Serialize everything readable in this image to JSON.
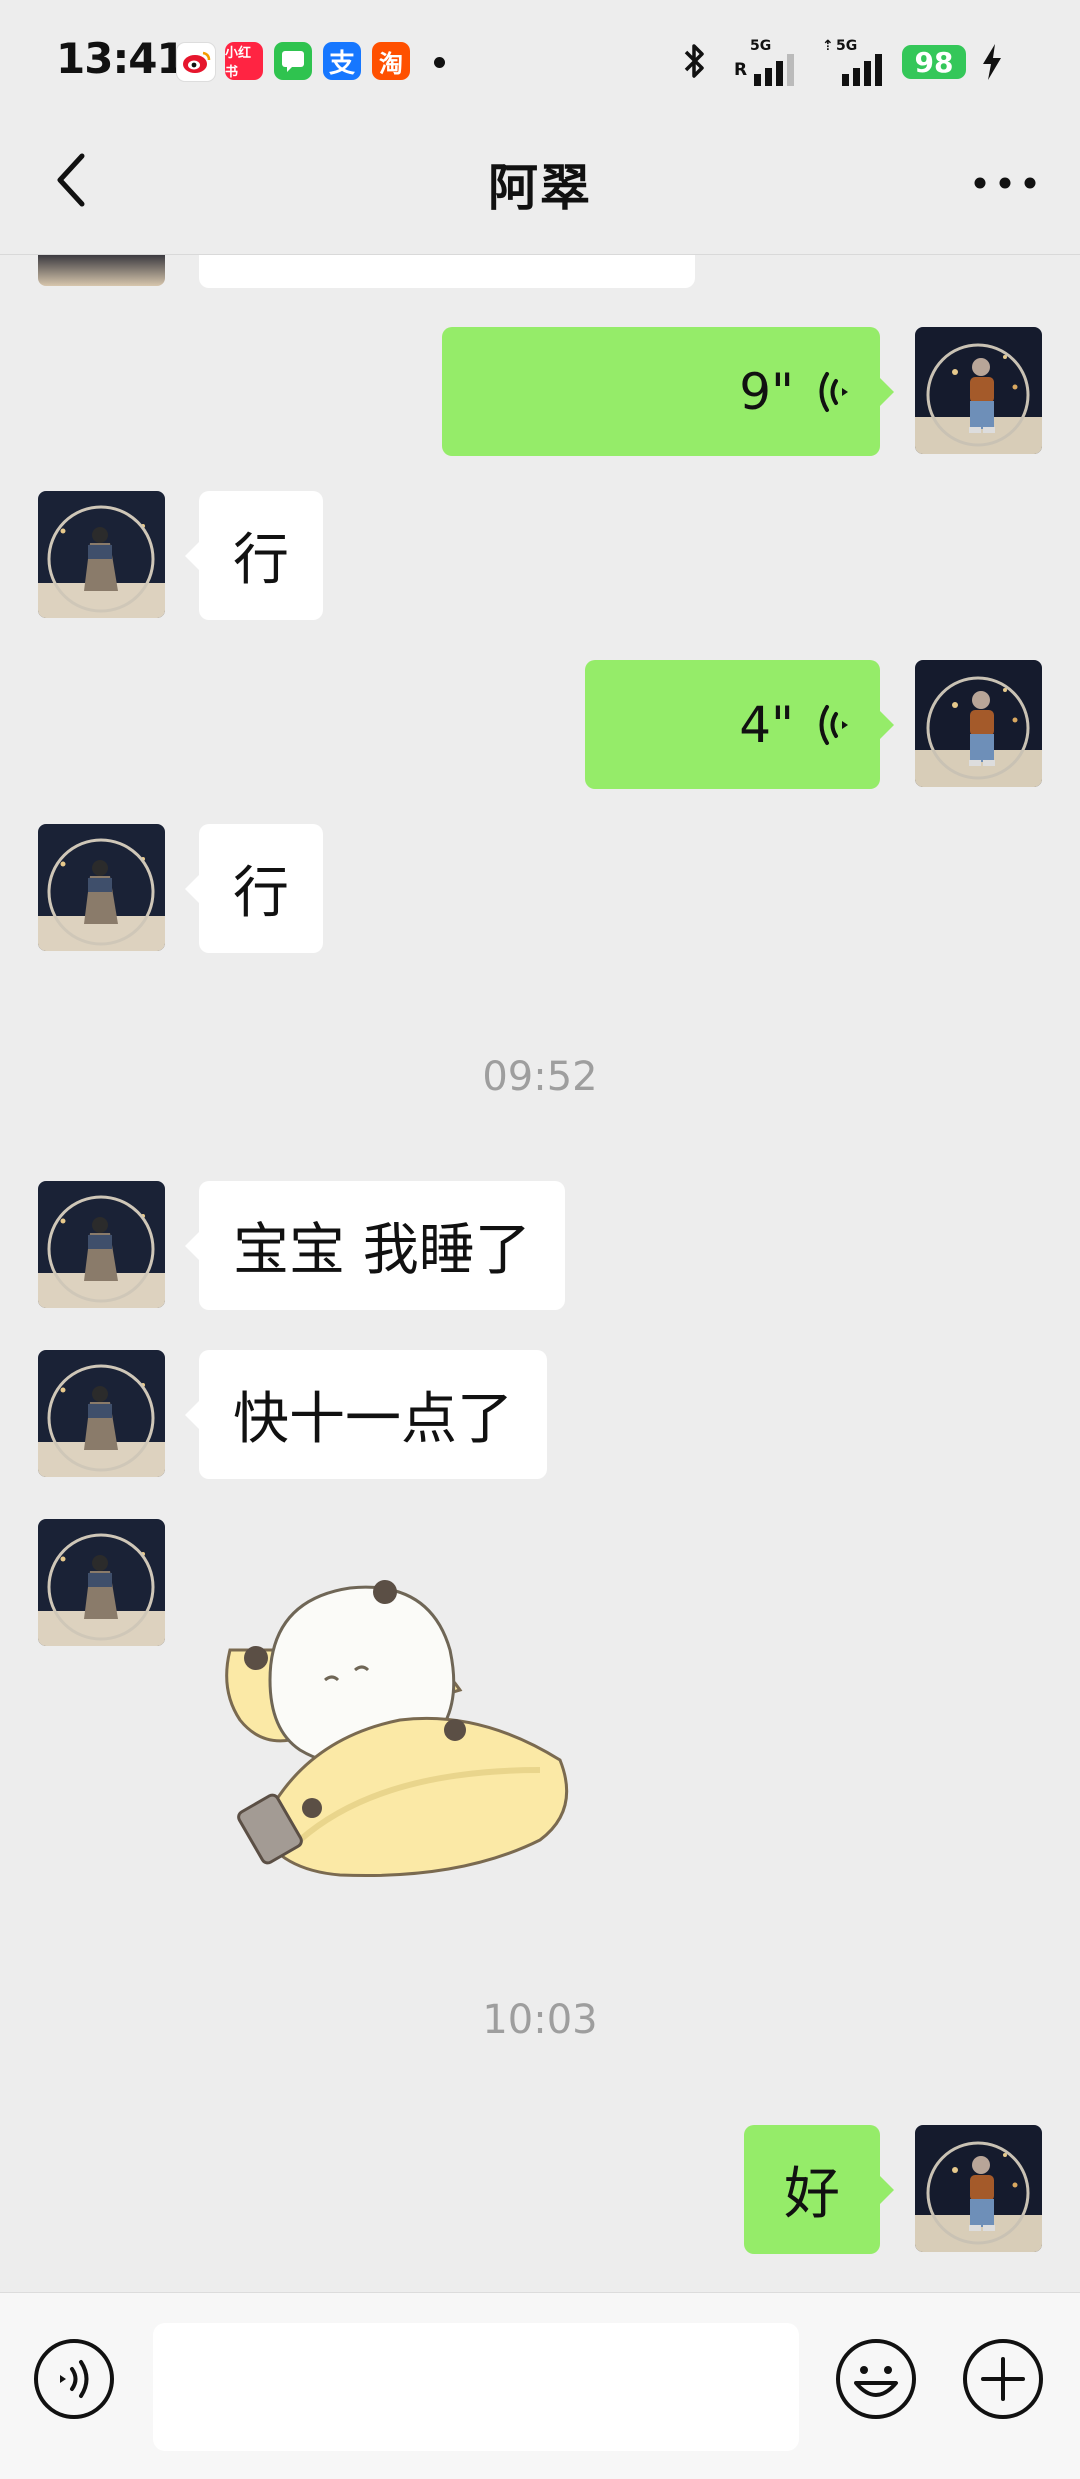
{
  "status_bar": {
    "time": "13:41",
    "battery": "98",
    "signal1_label": "5G",
    "signal1_sub": "R",
    "signal2_label": "5G",
    "app_icons": [
      "weibo-icon",
      "xiaohongshu-icon",
      "messages-icon",
      "alipay-icon",
      "taobao-icon"
    ],
    "xiaohongshu_text": "小红书",
    "alipay_text": "支",
    "taobao_text": "淘"
  },
  "header": {
    "title": "阿翠"
  },
  "messages": [
    {
      "type": "voice",
      "from": "me",
      "duration": "9\""
    },
    {
      "type": "text",
      "from": "them",
      "text": "行"
    },
    {
      "type": "voice",
      "from": "me",
      "duration": "4\""
    },
    {
      "type": "text",
      "from": "them",
      "text": "行"
    },
    {
      "type": "timestamp",
      "text": "09:52"
    },
    {
      "type": "text",
      "from": "them",
      "text": "宝宝 我睡了"
    },
    {
      "type": "text",
      "from": "them",
      "text": "快十一点了"
    },
    {
      "type": "sticker",
      "from": "them",
      "sticker": "sleeping-panda-sticker"
    },
    {
      "type": "timestamp",
      "text": "10:03"
    },
    {
      "type": "text",
      "from": "me",
      "text": "好"
    }
  ],
  "input_bar": {
    "value": "",
    "icons": [
      "voice-mode-icon",
      "emoji-icon",
      "plus-icon"
    ]
  },
  "colors": {
    "background": "#ededed",
    "outgoing_bubble": "#95ec69",
    "incoming_bubble": "#ffffff",
    "battery": "#34c759"
  }
}
